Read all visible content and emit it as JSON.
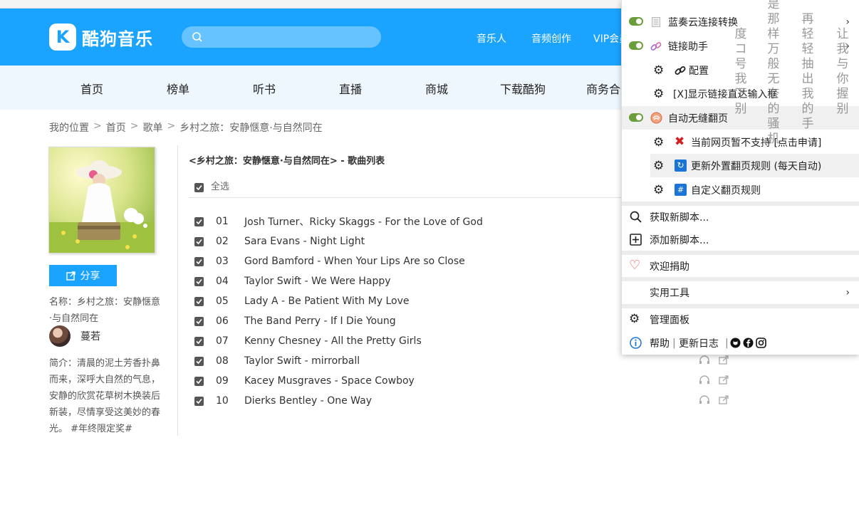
{
  "header": {
    "logo_letter": "K",
    "logo_text": "酷狗音乐",
    "search_placeholder": "",
    "nav": [
      "音乐人",
      "音频创作",
      "VIP会员"
    ]
  },
  "subnav": [
    "首页",
    "榜单",
    "听书",
    "直播",
    "商城",
    "下载酷狗",
    "商务合作"
  ],
  "breadcrumb": [
    "我的位置",
    "首页",
    "歌单",
    "乡村之旅：安静惬意·与自然同在"
  ],
  "album": {
    "share_label": "分享",
    "name_text": "名称：乡村之旅：安静惬意·与自然同在",
    "creator": "蔓若",
    "intro_text": "简介：清晨的泥土芳香扑鼻而来，深呼大自然的气息，安静的欣赏花草树木换装后新装，尽情享受这美妙的春光。 #年终限定奖#"
  },
  "list": {
    "title": "<乡村之旅：安静惬意·与自然同在> - 歌曲列表",
    "select_all": "全选",
    "songs": [
      {
        "num": "01",
        "title": "Josh Turner、Ricky Skaggs - For the Love of God"
      },
      {
        "num": "02",
        "title": "Sara Evans - Night Light"
      },
      {
        "num": "03",
        "title": "Gord Bamford - When Your Lips Are so Close"
      },
      {
        "num": "04",
        "title": "Taylor Swift - We Were Happy"
      },
      {
        "num": "05",
        "title": "Lady A - Be Patient With My Love"
      },
      {
        "num": "06",
        "title": "The Band Perry - If I Die Young"
      },
      {
        "num": "07",
        "title": "Kenny Chesney - All the Pretty Girls"
      },
      {
        "num": "08",
        "title": "Taylor Swift - mirrorball"
      },
      {
        "num": "09",
        "title": "Kacey Musgraves - Space Cowboy"
      },
      {
        "num": "10",
        "title": "Dierks Bentley - One Way"
      }
    ]
  },
  "menu": {
    "lanzou": "蓝奏云连接转换",
    "link_helper": "链接助手",
    "config": "配置",
    "show_link": "[X]显示链接直达输入框",
    "autopager": "自动无缝翻页",
    "not_supported": "当前网页暂不支持 [点击申请]",
    "update_rules": "更新外置翻页规则 (每天自动)",
    "custom_rules": "自定义翻页规则",
    "get_scripts": "获取新脚本...",
    "add_script": "添加新脚本...",
    "donate": "欢迎捐助",
    "tools": "实用工具",
    "dashboard": "管理面板",
    "help": "帮助",
    "changelog": "更新日志"
  },
  "danmaku": [
    {
      "text": "度コ号我下别"
    },
    {
      "text": "是那样万般无奈的骚机"
    },
    {
      "text": "再轻轻抽出我的手"
    },
    {
      "text": "让我与你握别"
    }
  ],
  "colors": {
    "brand": "#1aa3ff",
    "toggle_on": "#6a9e3a"
  }
}
